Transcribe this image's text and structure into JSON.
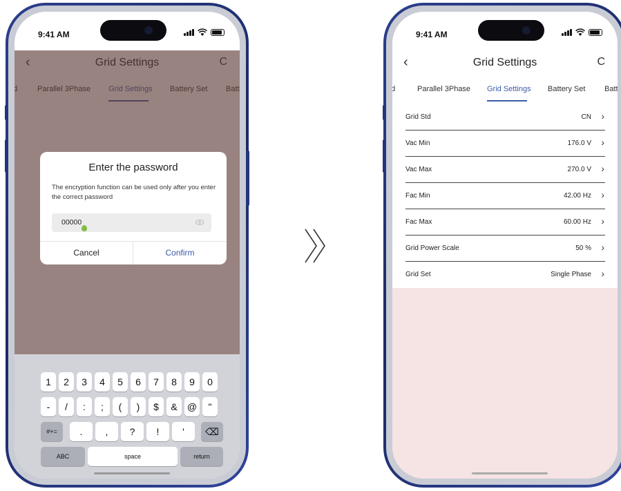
{
  "status_time": "9:41 AM",
  "nav": {
    "title": "Grid Settings",
    "back_icon": "‹",
    "refresh_icon": "C"
  },
  "tabs": [
    {
      "label": "d"
    },
    {
      "label": "Parallel 3Phase"
    },
    {
      "label": "Grid Settings",
      "active": true
    },
    {
      "label": "Battery Set"
    },
    {
      "label": "Batt"
    }
  ],
  "dialog": {
    "title": "Enter the password",
    "message": "The encryption function can be used only after you enter the correct password",
    "password_value": "00000",
    "cancel_label": "Cancel",
    "confirm_label": "Confirm"
  },
  "keyboard": {
    "row1": [
      "1",
      "2",
      "3",
      "4",
      "5",
      "6",
      "7",
      "8",
      "9",
      "0"
    ],
    "row2": [
      "-",
      "/",
      ":",
      ";",
      "(",
      ")",
      "$",
      "&",
      "@",
      "\""
    ],
    "row3_left": "#+=",
    "row3": [
      ".",
      ",",
      "?",
      "!",
      "'"
    ],
    "abc_label": "ABC",
    "space_label": "space",
    "return_label": "return",
    "delete_icon": "⌫"
  },
  "arrow_icon": "double-chevron-right-icon",
  "settings": [
    {
      "label": "Grid Std",
      "value": "CN"
    },
    {
      "label": "Vac Min",
      "value": "176.0 V"
    },
    {
      "label": "Vac Max",
      "value": "270.0 V"
    },
    {
      "label": "Fac Min",
      "value": "42.00 Hz"
    },
    {
      "label": "Fac Max",
      "value": "60.00 Hz"
    },
    {
      "label": "Grid Power Scale",
      "value": "50 %"
    },
    {
      "label": "Grid Set",
      "value": "Single Phase"
    }
  ],
  "chevron": "›",
  "colors": {
    "accent": "#3b5aa8",
    "phone_frame": "#23357a",
    "overlay": "#8a6560",
    "settings_background": "#f6e3e3"
  }
}
